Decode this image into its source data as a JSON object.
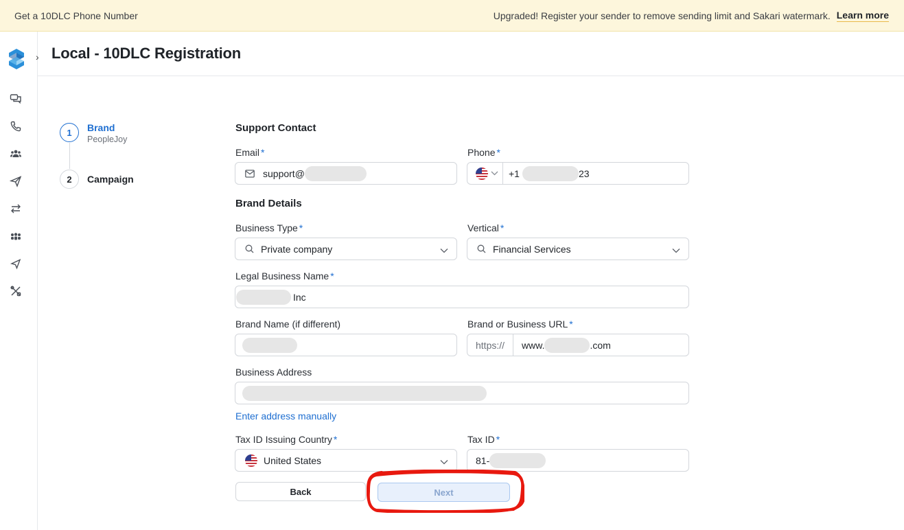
{
  "banner": {
    "left_text": "Get a 10DLC Phone Number",
    "message": "Upgraded! Register your sender to remove sending limit and Sakari watermark.",
    "learn_more": "Learn more"
  },
  "header": {
    "title": "Local - 10DLC Registration"
  },
  "sidebar": {
    "icons": [
      "conversations-icon",
      "phone-icon",
      "contacts-icon",
      "send-icon",
      "workflows-icon",
      "groups-icon",
      "campaigns-icon",
      "tools-icon"
    ]
  },
  "steps": [
    {
      "number": "1",
      "title": "Brand",
      "subtitle": "PeopleJoy",
      "active": true
    },
    {
      "number": "2",
      "title": "Campaign",
      "active": false
    }
  ],
  "support_contact": {
    "title": "Support Contact",
    "email": {
      "label": "Email",
      "value_prefix": "support@"
    },
    "phone": {
      "label": "Phone",
      "country_code": "+1",
      "value_suffix": "23"
    }
  },
  "brand_details": {
    "title": "Brand Details",
    "business_type": {
      "label": "Business Type",
      "value": "Private company"
    },
    "vertical": {
      "label": "Vertical",
      "value": "Financial Services"
    },
    "legal_name": {
      "label": "Legal Business Name",
      "value_suffix": "Inc"
    },
    "brand_name": {
      "label": "Brand Name (if different)"
    },
    "url": {
      "label": "Brand or Business URL",
      "prefix": "https://",
      "value_start": "www.",
      "value_end": ".com"
    },
    "address": {
      "label": "Business Address",
      "manual_link": "Enter address manually"
    },
    "tax_country": {
      "label": "Tax ID Issuing Country",
      "value": "United States"
    },
    "tax_id": {
      "label": "Tax ID",
      "value_prefix": "81-"
    }
  },
  "buttons": {
    "back": "Back",
    "next": "Next"
  },
  "colors": {
    "accent": "#1f6fd1",
    "annotation": "#e8190f",
    "banner_bg": "#fdf6dc"
  }
}
